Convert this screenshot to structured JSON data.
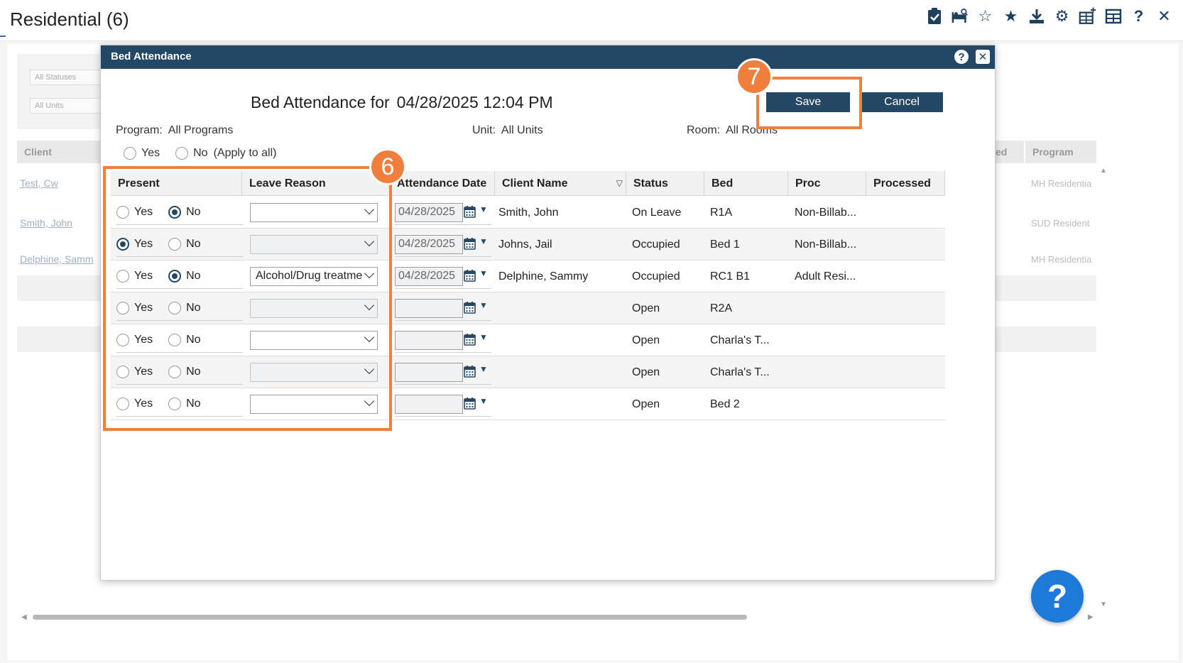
{
  "page": {
    "title": "Residential (6)",
    "toolbar_icons": [
      "clipboard-check-icon",
      "bed-search-icon",
      "star-outline-icon",
      "star-icon",
      "download-icon",
      "gear-icon",
      "grid-add-icon",
      "grid-icon",
      "help-icon",
      "close-icon"
    ]
  },
  "background": {
    "filters": [
      "All Statuses",
      "All Units"
    ],
    "columns": [
      "Client",
      "ed",
      "Program"
    ],
    "rows": [
      {
        "client": "Test, Cw",
        "program": "MH Residentia"
      },
      {
        "client": "Smith, John",
        "program": "SUD Resident"
      },
      {
        "client": "Delphine, Samm",
        "program": "MH Residentia"
      }
    ],
    "help_button": "?"
  },
  "modal": {
    "title": "Bed Attendance",
    "heading_prefix": "Bed Attendance for",
    "heading_date": "04/28/2025 12:04 PM",
    "save_label": "Save",
    "cancel_label": "Cancel",
    "program_label": "Program:",
    "program_value": "All Programs",
    "unit_label": "Unit:",
    "unit_value": "All Units",
    "room_label": "Room:",
    "room_value": "All Rooms",
    "apply_yes": "Yes",
    "apply_no": "No",
    "apply_note": "(Apply to all)"
  },
  "table": {
    "columns": [
      "Present",
      "Leave Reason",
      "Attendance Date",
      "Client Name",
      "Status",
      "Bed",
      "Proc",
      "Processed"
    ],
    "yes_label": "Yes",
    "no_label": "No",
    "rows": [
      {
        "present": "No",
        "leave_reason": "",
        "attendance_date": "04/28/2025",
        "client_name": "Smith, John",
        "status": "On Leave",
        "bed": "R1A",
        "proc": "Non-Billab...",
        "processed": ""
      },
      {
        "present": "Yes",
        "leave_reason": "",
        "attendance_date": "04/28/2025",
        "client_name": "Johns, Jail",
        "status": "Occupied",
        "bed": "Bed 1",
        "proc": "Non-Billab...",
        "processed": ""
      },
      {
        "present": "No",
        "leave_reason": "Alcohol/Drug treatme",
        "attendance_date": "04/28/2025",
        "client_name": "Delphine, Sammy",
        "status": "Occupied",
        "bed": "RC1 B1",
        "proc": "Adult Resi...",
        "processed": ""
      },
      {
        "present": "",
        "leave_reason": "",
        "attendance_date": "",
        "client_name": "",
        "status": "Open",
        "bed": "R2A",
        "proc": "",
        "processed": ""
      },
      {
        "present": "",
        "leave_reason": "",
        "attendance_date": "",
        "client_name": "",
        "status": "Open",
        "bed": "Charla's T...",
        "proc": "",
        "processed": ""
      },
      {
        "present": "",
        "leave_reason": "",
        "attendance_date": "",
        "client_name": "",
        "status": "Open",
        "bed": "Charla's T...",
        "proc": "",
        "processed": ""
      },
      {
        "present": "",
        "leave_reason": "",
        "attendance_date": "",
        "client_name": "",
        "status": "Open",
        "bed": "Bed 2",
        "proc": "",
        "processed": ""
      }
    ]
  },
  "callouts": [
    {
      "number": "6",
      "target": "present and leave reason columns"
    },
    {
      "number": "7",
      "target": "save button"
    }
  ],
  "colors": {
    "header_navy": "#244765",
    "callout_orange": "#f07e3c",
    "help_blue": "#1e7ad8"
  }
}
